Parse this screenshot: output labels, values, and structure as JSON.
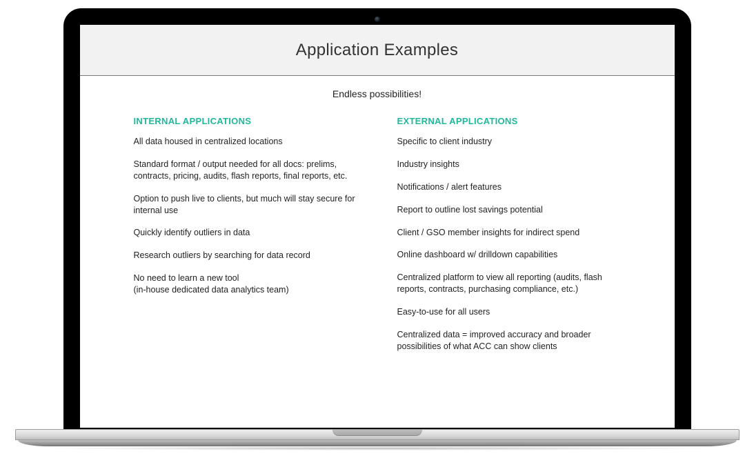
{
  "header": {
    "title": "Application Examples"
  },
  "subtitle": "Endless possibilities!",
  "internal": {
    "heading": "INTERNAL APPLICATIONS",
    "items": [
      "All data housed in centralized locations",
      "Standard format / output needed for all docs: prelims, contracts, pricing, audits, flash reports, final reports, etc.",
      "Option to push live to clients, but much will stay secure for internal use",
      "Quickly identify outliers in data",
      "Research outliers by searching for data record",
      "No need to learn a new tool\n(in-house dedicated data analytics team)"
    ]
  },
  "external": {
    "heading": "EXTERNAL APPLICATIONS",
    "items": [
      "Specific to client industry",
      "Industry insights",
      "Notifications / alert features",
      "Report to outline lost savings potential",
      "Client / GSO member insights for indirect spend",
      "Online dashboard w/ drilldown capabilities",
      "Centralized platform to view all reporting (audits, flash reports, contracts, purchasing compliance, etc.)",
      "Easy-to-use for all users",
      "Centralized data = improved accuracy and broader possibilities of what ACC can show clients"
    ]
  }
}
